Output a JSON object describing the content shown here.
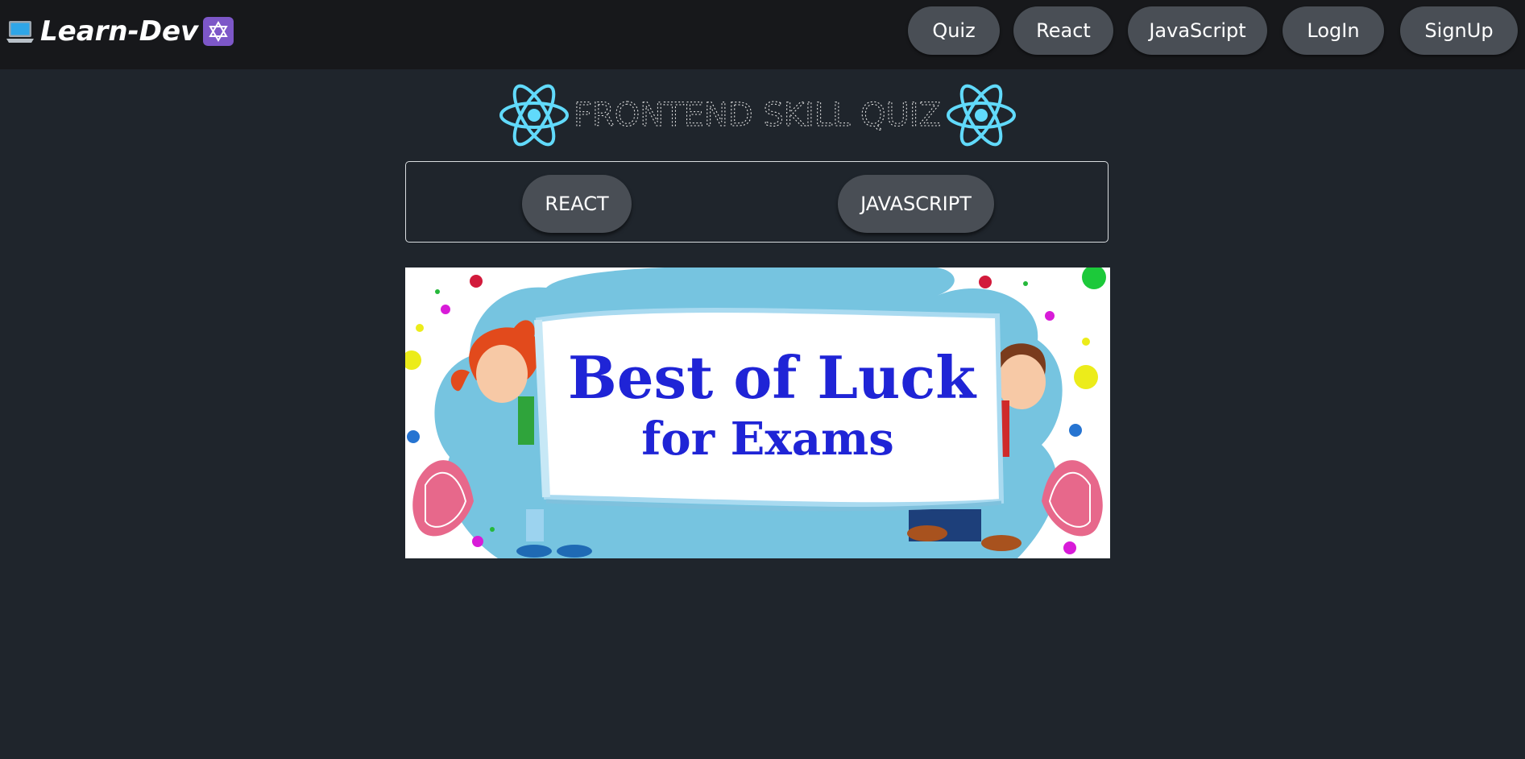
{
  "app": {
    "brand": "Learn-Dev",
    "brand_icons": [
      "laptop-icon",
      "star-of-david-icon"
    ]
  },
  "nav": {
    "items": [
      "Quiz",
      "React",
      "JavaScript",
      "LogIn",
      "SignUp"
    ]
  },
  "hero": {
    "title": "FRONTEND SKILL QUIZ",
    "icons": [
      "react-logo-icon",
      "react-logo-icon"
    ]
  },
  "quiz_categories": [
    "REACT",
    "JAVASCRIPT"
  ],
  "banner": {
    "line1": "Best of Luck",
    "line2": "for Exams"
  },
  "colors": {
    "page_bg": "#1f252c",
    "topbar_bg": "#17181b",
    "button_bg": "#494e55",
    "react_cyan": "#61dafb",
    "badge_purple": "#7d57c8",
    "banner_text": "#1f24d6"
  }
}
